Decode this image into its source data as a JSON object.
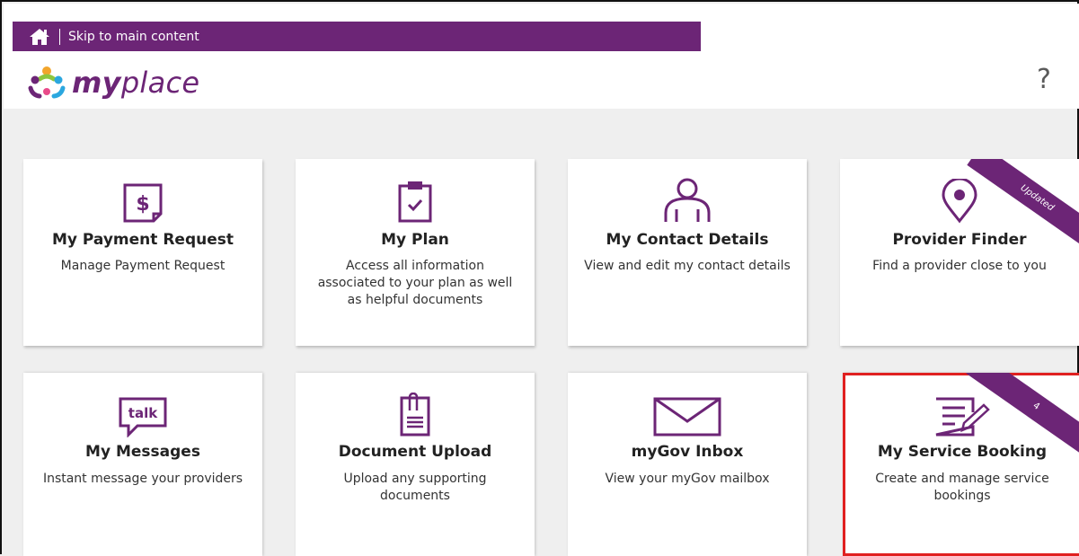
{
  "header": {
    "skip_link": "Skip to main content",
    "logo": {
      "bold": "my",
      "light": "place"
    },
    "help": "?"
  },
  "tiles": [
    {
      "title": "My Payment Request",
      "desc": "Manage Payment Request",
      "icon": "payment-request-icon"
    },
    {
      "title": "My Plan",
      "desc": "Access all information associated to your plan as well as helpful documents",
      "icon": "plan-clipboard-icon"
    },
    {
      "title": "My Contact Details",
      "desc": "View and edit my contact details",
      "icon": "contact-person-icon"
    },
    {
      "title": "Provider Finder",
      "desc": "Find a provider close to you",
      "icon": "location-pin-icon",
      "ribbon": "Updated"
    },
    {
      "title": "My Messages",
      "desc": "Instant message your providers",
      "icon": "talk-bubble-icon",
      "icon_text": "talk"
    },
    {
      "title": "Document Upload",
      "desc": "Upload any supporting documents",
      "icon": "document-clip-icon"
    },
    {
      "title": "myGov Inbox",
      "desc": "View your myGov mailbox",
      "icon": "envelope-icon"
    },
    {
      "title": "My Service Booking",
      "desc": "Create and manage service bookings",
      "icon": "service-booking-icon",
      "ribbon": "4",
      "highlighted": true
    }
  ],
  "colors": {
    "brand": "#6c2576",
    "highlight": "#e02020"
  }
}
